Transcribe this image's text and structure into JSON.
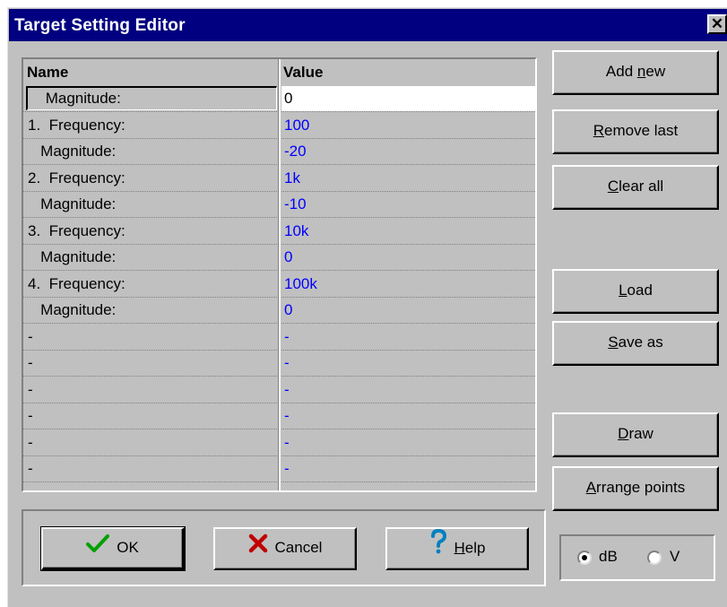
{
  "window": {
    "title": "Target Setting Editor",
    "close_glyph": "✕"
  },
  "grid": {
    "headers": {
      "name": "Name",
      "value": "Value"
    },
    "rows": [
      {
        "name": " Magnitude:",
        "value": "0"
      },
      {
        "name": "1.  Frequency:",
        "value": "100"
      },
      {
        "name": "   Magnitude:",
        "value": "-20"
      },
      {
        "name": "2.  Frequency:",
        "value": "1k"
      },
      {
        "name": "   Magnitude:",
        "value": "-10"
      },
      {
        "name": "3.  Frequency:",
        "value": "10k"
      },
      {
        "name": "   Magnitude:",
        "value": "0"
      },
      {
        "name": "4.  Frequency:",
        "value": "100k"
      },
      {
        "name": "   Magnitude:",
        "value": "0"
      },
      {
        "name": "-",
        "value": "-"
      },
      {
        "name": "-",
        "value": "-"
      },
      {
        "name": "-",
        "value": "-"
      },
      {
        "name": "-",
        "value": "-"
      },
      {
        "name": "-",
        "value": "-"
      },
      {
        "name": "-",
        "value": "-"
      }
    ]
  },
  "side_buttons": {
    "add_new": {
      "pre": "Add ",
      "key": "n",
      "post": "ew"
    },
    "remove_last": {
      "pre": "",
      "key": "R",
      "post": "emove last"
    },
    "clear_all": {
      "pre": "",
      "key": "C",
      "post": "lear all"
    },
    "load": {
      "pre": "",
      "key": "L",
      "post": "oad"
    },
    "save_as": {
      "pre": "",
      "key": "S",
      "post": "ave as"
    },
    "draw": {
      "pre": "",
      "key": "D",
      "post": "raw"
    },
    "arrange_points": {
      "pre": "",
      "key": "A",
      "post": "rrange points"
    }
  },
  "bottom_buttons": {
    "ok": {
      "label": "OK",
      "icon": "check-icon"
    },
    "cancel": {
      "label": "Cancel",
      "icon": "x-icon"
    },
    "help": {
      "pre": "",
      "key": "H",
      "post": "elp",
      "icon": "question-icon"
    }
  },
  "units": {
    "db": "dB",
    "v": "V",
    "selected": "dB"
  },
  "colors": {
    "title_bar": "#000080",
    "value_text": "#0000ff",
    "face": "#c0c0c0",
    "check": "#00a000",
    "cancel_x": "#c00000",
    "help_q": "#0080c0"
  }
}
